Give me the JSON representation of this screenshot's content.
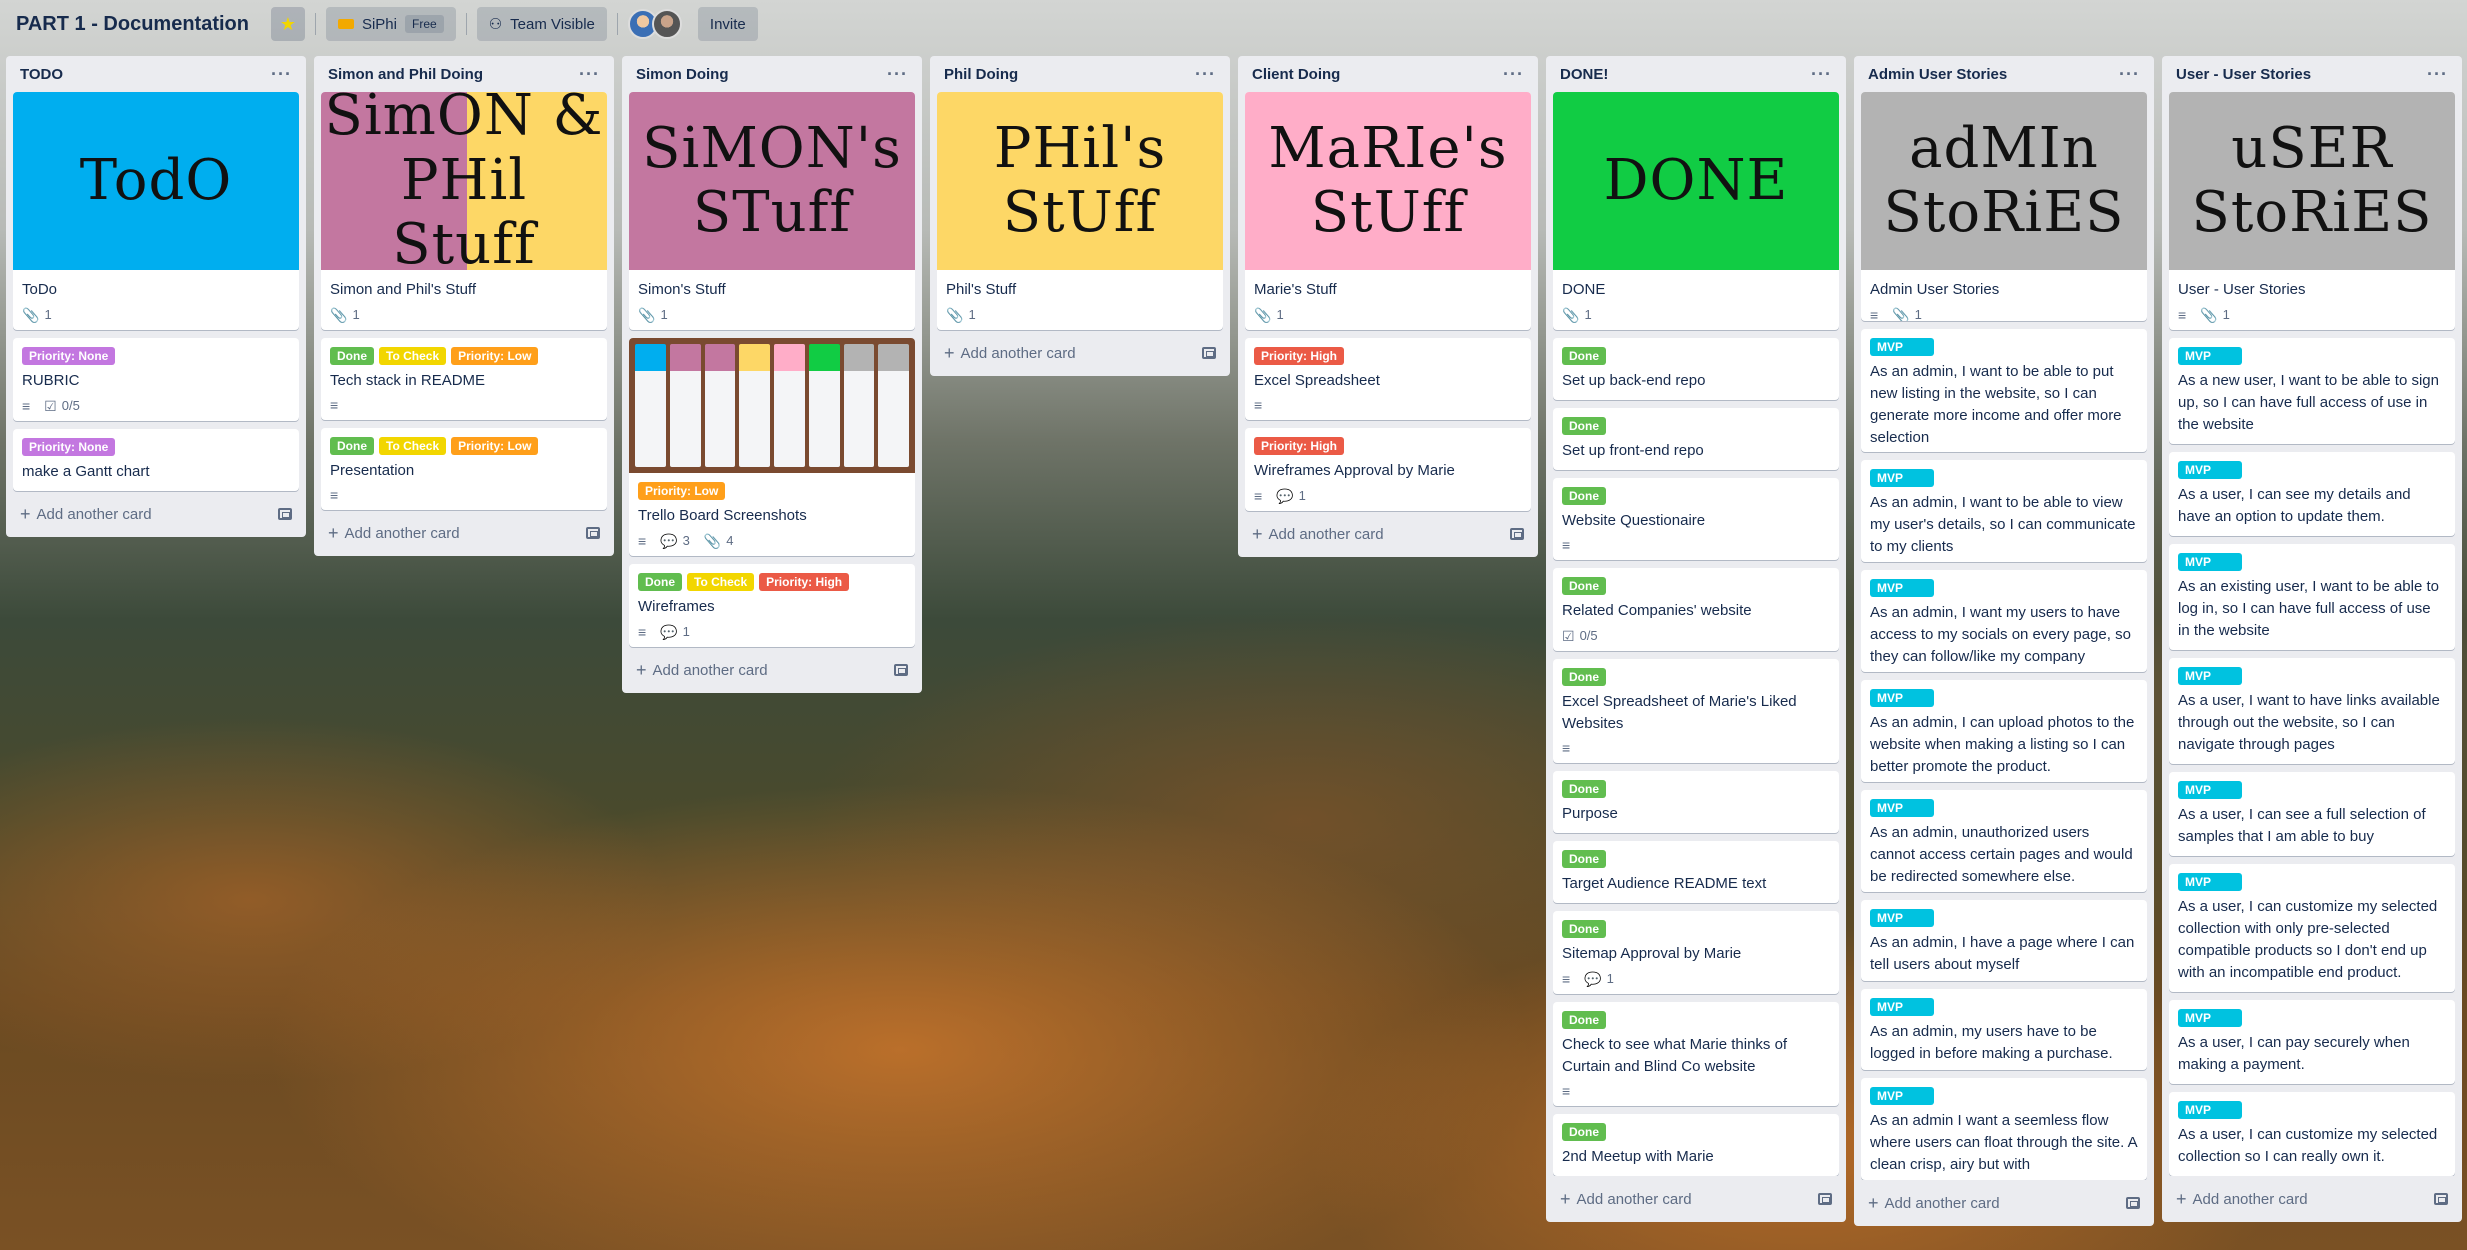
{
  "board": {
    "title": "PART 1 - Documentation",
    "team_name": "SiPhi",
    "team_badge": "Free",
    "visibility": "Team Visible",
    "invite": "Invite"
  },
  "colors": {
    "green": "#61bd4f",
    "yellow": "#f2d600",
    "orange": "#ff9f1a",
    "purple": "#c377e0",
    "red": "#eb5a46",
    "sky": "#00c2e0"
  },
  "add_card_label": "Add another card",
  "lists": [
    {
      "title": "TODO",
      "cards": [
        {
          "cover": {
            "text": "TodO",
            "color": "#00aeef"
          },
          "title": "ToDo",
          "labels": [],
          "badges": [
            {
              "icon": "paperclip-icon",
              "text": "1"
            }
          ]
        },
        {
          "title": "RUBRIC",
          "labels": [
            {
              "text": "Priority: None",
              "color": "purple"
            }
          ],
          "badges": [
            {
              "icon": "description-icon",
              "text": ""
            },
            {
              "icon": "checklist-icon",
              "text": "0/5"
            }
          ]
        },
        {
          "title": "make a Gantt chart",
          "labels": [
            {
              "text": "Priority: None",
              "color": "purple"
            }
          ],
          "badges": []
        }
      ]
    },
    {
      "title": "Simon and Phil Doing",
      "cards": [
        {
          "cover": {
            "text": "SimON & PHil Stuff",
            "color": "split"
          },
          "title": "Simon and Phil's Stuff",
          "labels": [],
          "badges": [
            {
              "icon": "paperclip-icon",
              "text": "1"
            }
          ]
        },
        {
          "title": "Tech stack in README",
          "labels": [
            {
              "text": "Done",
              "color": "green"
            },
            {
              "text": "To Check",
              "color": "yellow"
            },
            {
              "text": "Priority: Low",
              "color": "orange"
            }
          ],
          "badges": [
            {
              "icon": "description-icon",
              "text": ""
            }
          ]
        },
        {
          "title": "Presentation",
          "labels": [
            {
              "text": "Done",
              "color": "green"
            },
            {
              "text": "To Check",
              "color": "yellow"
            },
            {
              "text": "Priority: Low",
              "color": "orange"
            }
          ],
          "badges": [
            {
              "icon": "description-icon",
              "text": ""
            }
          ]
        }
      ]
    },
    {
      "title": "Simon Doing",
      "cards": [
        {
          "cover": {
            "text": "SiMON's STuff",
            "color": "#c377a0"
          },
          "title": "Simon's Stuff",
          "labels": [],
          "badges": [
            {
              "icon": "paperclip-icon",
              "text": "1"
            }
          ]
        },
        {
          "screenshot": true,
          "title": "Trello Board Screenshots",
          "labels": [
            {
              "text": "Priority: Low",
              "color": "orange"
            }
          ],
          "badges": [
            {
              "icon": "description-icon",
              "text": ""
            },
            {
              "icon": "comment-icon",
              "text": "3"
            },
            {
              "icon": "paperclip-icon",
              "text": "4"
            }
          ]
        },
        {
          "title": "Wireframes",
          "labels": [
            {
              "text": "Done",
              "color": "green"
            },
            {
              "text": "To Check",
              "color": "yellow"
            },
            {
              "text": "Priority: High",
              "color": "red"
            }
          ],
          "badges": [
            {
              "icon": "description-icon",
              "text": ""
            },
            {
              "icon": "comment-icon",
              "text": "1"
            }
          ]
        }
      ]
    },
    {
      "title": "Phil Doing",
      "cards": [
        {
          "cover": {
            "text": "PHil's StUff",
            "color": "#fdd766"
          },
          "title": "Phil's Stuff",
          "labels": [],
          "badges": [
            {
              "icon": "paperclip-icon",
              "text": "1"
            }
          ]
        }
      ]
    },
    {
      "title": "Client Doing",
      "cards": [
        {
          "cover": {
            "text": "MaRIe's StUff",
            "color": "#ffadc8"
          },
          "title": "Marie's Stuff",
          "labels": [],
          "badges": [
            {
              "icon": "paperclip-icon",
              "text": "1"
            }
          ]
        },
        {
          "title": "Excel Spreadsheet",
          "labels": [
            {
              "text": "Priority: High",
              "color": "red"
            }
          ],
          "badges": [
            {
              "icon": "description-icon",
              "text": ""
            }
          ]
        },
        {
          "title": "Wireframes Approval by Marie",
          "labels": [
            {
              "text": "Priority: High",
              "color": "red"
            }
          ],
          "badges": [
            {
              "icon": "description-icon",
              "text": ""
            },
            {
              "icon": "comment-icon",
              "text": "1"
            }
          ]
        }
      ]
    },
    {
      "title": "DONE!",
      "scroll": true,
      "cards": [
        {
          "cover": {
            "text": "DONE",
            "color": "#11cc44"
          },
          "title": "DONE",
          "labels": [],
          "badges": [
            {
              "icon": "paperclip-icon",
              "text": "1"
            }
          ]
        },
        {
          "title": "Set up back-end repo",
          "labels": [
            {
              "text": "Done",
              "color": "green"
            }
          ],
          "badges": []
        },
        {
          "title": "Set up front-end repo",
          "labels": [
            {
              "text": "Done",
              "color": "green"
            }
          ],
          "badges": []
        },
        {
          "title": "Website Questionaire",
          "labels": [
            {
              "text": "Done",
              "color": "green"
            }
          ],
          "badges": [
            {
              "icon": "description-icon",
              "text": ""
            }
          ]
        },
        {
          "title": "Related Companies' website",
          "labels": [
            {
              "text": "Done",
              "color": "green"
            }
          ],
          "badges": [
            {
              "icon": "checklist-icon",
              "text": "0/5"
            }
          ]
        },
        {
          "title": "Excel Spreadsheet of Marie's Liked Websites",
          "labels": [
            {
              "text": "Done",
              "color": "green"
            }
          ],
          "badges": [
            {
              "icon": "description-icon",
              "text": ""
            }
          ]
        },
        {
          "title": "Purpose",
          "labels": [
            {
              "text": "Done",
              "color": "green"
            }
          ],
          "badges": []
        },
        {
          "title": "Target Audience README text",
          "labels": [
            {
              "text": "Done",
              "color": "green"
            }
          ],
          "badges": []
        },
        {
          "title": "Sitemap Approval by Marie",
          "labels": [
            {
              "text": "Done",
              "color": "green"
            }
          ],
          "badges": [
            {
              "icon": "description-icon",
              "text": ""
            },
            {
              "icon": "comment-icon",
              "text": "1"
            }
          ]
        },
        {
          "title": "Check to see what Marie thinks of Curtain and Blind Co website",
          "labels": [
            {
              "text": "Done",
              "color": "green"
            }
          ],
          "badges": [
            {
              "icon": "description-icon",
              "text": ""
            }
          ]
        },
        {
          "title": "2nd Meetup with Marie",
          "labels": [
            {
              "text": "Done",
              "color": "green"
            }
          ],
          "badges": []
        }
      ]
    },
    {
      "title": "Admin User Stories",
      "scroll": true,
      "cards": [
        {
          "cover": {
            "text": "adMIn StoRiES",
            "color": "#b3b3b3"
          },
          "title": "Admin User Stories",
          "labels": [],
          "badges": [
            {
              "icon": "description-icon",
              "text": ""
            },
            {
              "icon": "paperclip-icon",
              "text": "1"
            }
          ]
        },
        {
          "title": "As an admin, I want to be able to put new listing in the website, so I can generate more income and offer more selection",
          "labels": [
            {
              "text": "MVP",
              "color": "sky"
            }
          ],
          "badges": []
        },
        {
          "title": "As an admin, I want to be able to view my user's details, so I can communicate to my clients",
          "labels": [
            {
              "text": "MVP",
              "color": "sky"
            }
          ],
          "badges": []
        },
        {
          "title": "As an admin, I want my users to have access to my socials on every page, so they can follow/like my company",
          "labels": [
            {
              "text": "MVP",
              "color": "sky"
            }
          ],
          "badges": []
        },
        {
          "title": "As an admin, I can upload photos to the website when making a listing so I can better promote the product.",
          "labels": [
            {
              "text": "MVP",
              "color": "sky"
            }
          ],
          "badges": []
        },
        {
          "title": "As an admin, unauthorized users cannot access certain pages and would be redirected somewhere else.",
          "labels": [
            {
              "text": "MVP",
              "color": "sky"
            }
          ],
          "badges": []
        },
        {
          "title": "As an admin, I have a page where I can tell users about myself",
          "labels": [
            {
              "text": "MVP",
              "color": "sky"
            }
          ],
          "badges": []
        },
        {
          "title": "As an admin, my users have to be logged in before making a purchase.",
          "labels": [
            {
              "text": "MVP",
              "color": "sky"
            }
          ],
          "badges": []
        },
        {
          "title": "As an admin I want a seemless flow where users can float through the site. A clean crisp, airy but with",
          "labels": [
            {
              "text": "MVP",
              "color": "sky"
            }
          ],
          "badges": []
        }
      ]
    },
    {
      "title": "User - User Stories",
      "scroll": true,
      "cards": [
        {
          "cover": {
            "text": "uSER StoRiES",
            "color": "#b3b3b3"
          },
          "title": "User - User Stories",
          "labels": [],
          "badges": [
            {
              "icon": "description-icon",
              "text": ""
            },
            {
              "icon": "paperclip-icon",
              "text": "1"
            }
          ]
        },
        {
          "title": "As a new user, I want to be able to sign up, so I can have full access of use in the website",
          "labels": [
            {
              "text": "MVP",
              "color": "sky"
            }
          ],
          "badges": []
        },
        {
          "title": "As a user, I can see my details and have an option to update them.",
          "labels": [
            {
              "text": "MVP",
              "color": "sky"
            }
          ],
          "badges": []
        },
        {
          "title": "As an existing user, I want to be able to log in, so I can have full access of use in the website",
          "labels": [
            {
              "text": "MVP",
              "color": "sky"
            }
          ],
          "badges": []
        },
        {
          "title": "As a user, I want to have links available through out the website, so I can navigate through pages",
          "labels": [
            {
              "text": "MVP",
              "color": "sky"
            }
          ],
          "badges": []
        },
        {
          "title": "As a user, I can see a full selection of samples that I am able to buy",
          "labels": [
            {
              "text": "MVP",
              "color": "sky"
            }
          ],
          "badges": []
        },
        {
          "title": "As a user, I can customize my selected collection with only pre-selected compatible products so I don't end up with an incompatible end product.",
          "labels": [
            {
              "text": "MVP",
              "color": "sky"
            }
          ],
          "badges": []
        },
        {
          "title": "As a user, I can pay securely when making a payment.",
          "labels": [
            {
              "text": "MVP",
              "color": "sky"
            }
          ],
          "badges": []
        },
        {
          "title": "As a user, I can customize my selected collection so I can really own it.",
          "labels": [
            {
              "text": "MVP",
              "color": "sky"
            }
          ],
          "badges": []
        }
      ]
    }
  ]
}
